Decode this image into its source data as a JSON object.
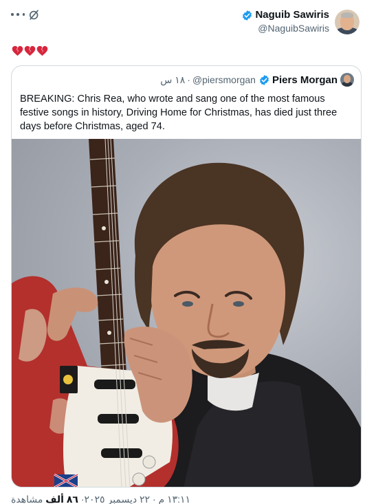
{
  "tweet": {
    "author_name": "Naguib Sawiris",
    "author_handle": "@NaguibSawiris",
    "text_emojis": [
      "broken-heart",
      "broken-heart",
      "broken-heart"
    ],
    "meta_date": "١٣:١١ م · ٢٢ ديسمبر ٢٠٢٥",
    "meta_views_prefix": "· ",
    "meta_views_count": "٨٦ ألف",
    "meta_views_suffix": " مشاهدة"
  },
  "quote": {
    "author_name": "Piers Morgan",
    "author_handle": "@piersmorgan",
    "separator": "·",
    "time": "١٨ س",
    "text": "BREAKING: Chris Rea, who wrote and sang one of the most famous festive songs in history, Driving Home for Christmas, has died just three days before Christmas, aged 74."
  },
  "icons": {
    "more": "more-dots-icon",
    "grok": "grok-icon",
    "verified": "verified-badge-icon",
    "broken_heart": "broken-heart-emoji"
  },
  "colors": {
    "text_primary": "#0f1419",
    "text_secondary": "#536471",
    "verified_blue": "#1d9bf0",
    "border": "#cfd9de",
    "heart_red": "#d7263d"
  }
}
